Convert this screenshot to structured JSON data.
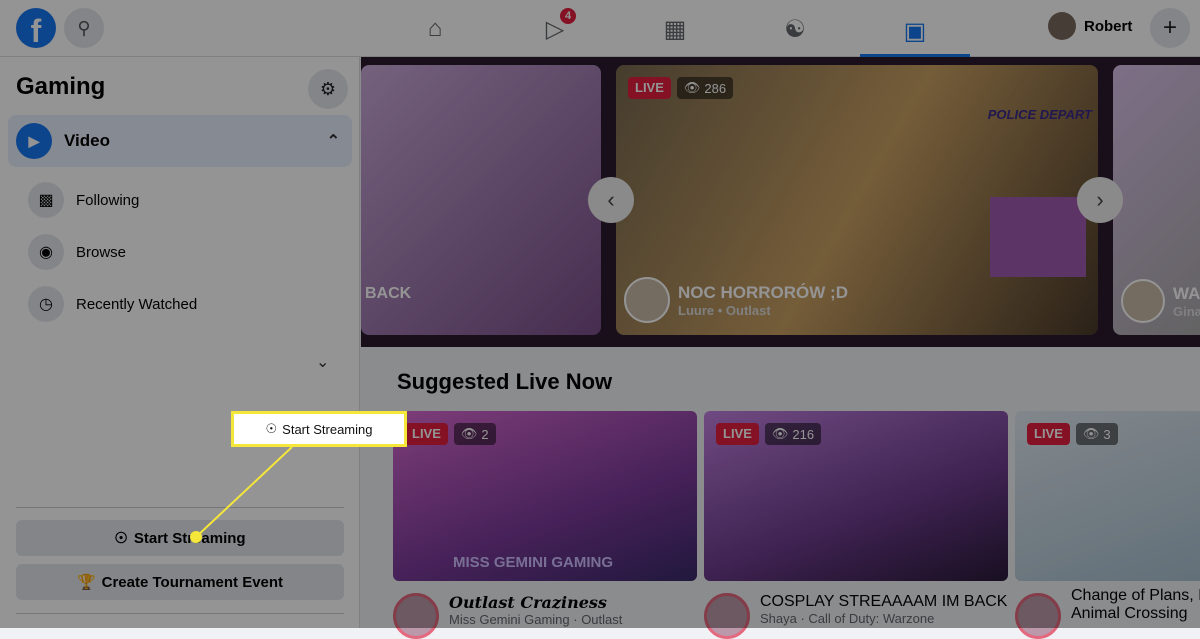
{
  "topbar": {
    "logo": "f",
    "badge": "4",
    "profile_name": "Robert",
    "nav": [
      {
        "icon": "home-icon"
      },
      {
        "icon": "watch-icon"
      },
      {
        "icon": "marketplace-icon"
      },
      {
        "icon": "groups-icon"
      },
      {
        "icon": "gaming-icon",
        "active": true
      }
    ]
  },
  "sidebar": {
    "title": "Gaming",
    "video_label": "Video",
    "items": [
      {
        "label": "Following",
        "icon": "following-icon"
      },
      {
        "label": "Browse",
        "icon": "binoculars-icon"
      },
      {
        "label": "Recently Watched",
        "icon": "clock-icon"
      }
    ],
    "start_streaming": "Start Streaming",
    "create_tournament": "Create Tournament Event"
  },
  "carousel": {
    "left_partial": "BACK",
    "main": {
      "live": "LIVE",
      "views": "286",
      "title": "NOC HORRORÓW ;D",
      "subtitle": "Luure • Outlast",
      "overlay_text": "POLICE DEPART"
    },
    "right_partial": {
      "title": "WA",
      "subtitle": "Gina"
    }
  },
  "suggested": {
    "heading": "Suggested Live Now",
    "cards": [
      {
        "live": "LIVE",
        "views": "2",
        "title": "Outlast Craziness",
        "subtitle": "Miss Gemini Gaming · Outlast",
        "banner": "MISS GEMINI GAMING"
      },
      {
        "live": "LIVE",
        "views": "216",
        "title": "COSPLAY STREAAAAM IM BACK",
        "subtitle": "Shaya · Call of Duty: Warzone"
      },
      {
        "live": "LIVE",
        "views": "3",
        "title": "Change of Plans, L",
        "subtitle": "Animal Crossing"
      }
    ]
  },
  "callout": {
    "label": "Start Streaming",
    "color": "#f5e63a"
  },
  "colors": {
    "brand": "#1877f2",
    "live": "#e41e3f"
  }
}
